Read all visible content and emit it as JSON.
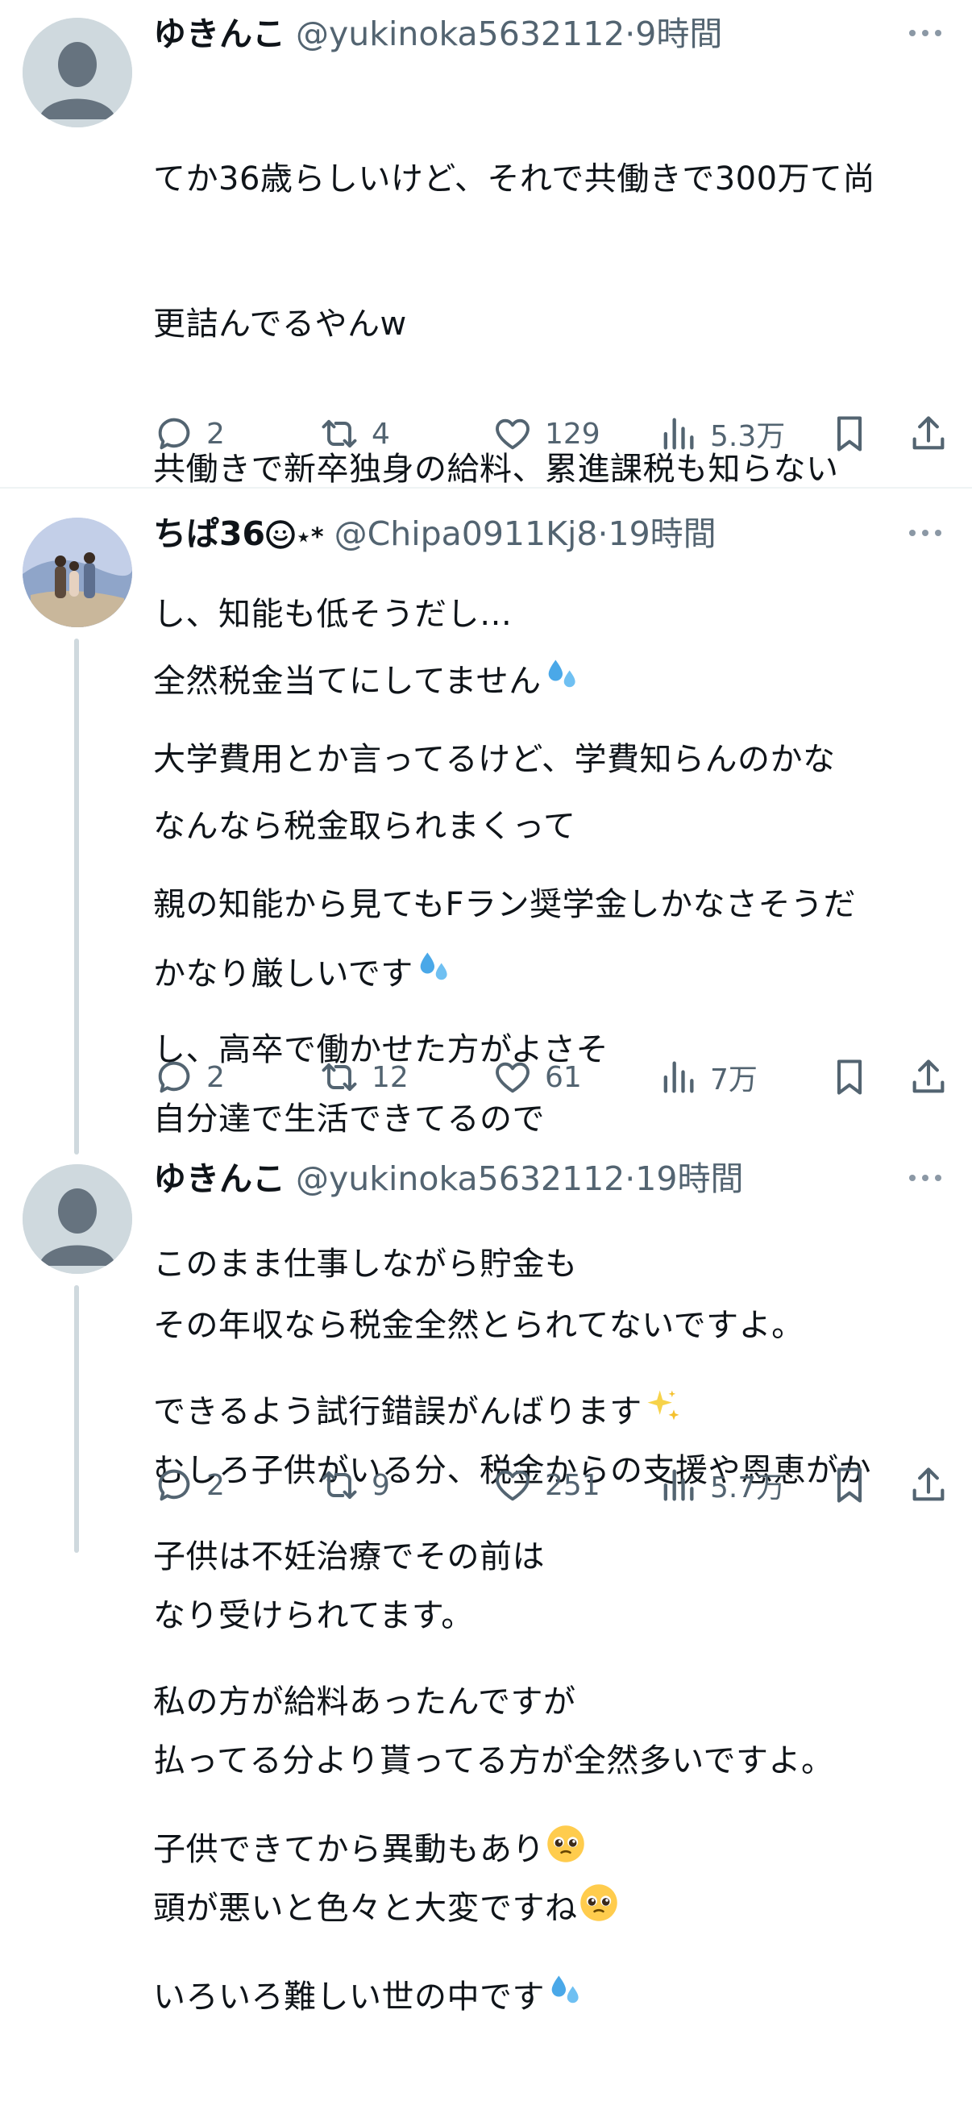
{
  "tweets": [
    {
      "name": "ゆきんこ",
      "handle": "@yukinoka5632112",
      "dot": "·",
      "time": "9時間",
      "lines": [
        "てか36歳らしいけど、それで共働きで300万て尚",
        "更詰んでるやんw",
        "共働きで新卒独身の給料、累進課税も知らない",
        "し、知能も低そうだし…",
        "大学費用とか言ってるけど、学費知らんのかな",
        "親の知能から見てもFラン奨学金しかなさそうだ",
        "し、高卒で働かせた方がよさそ"
      ],
      "replies": "2",
      "reposts": "4",
      "likes": "129",
      "views": "5.3万"
    },
    {
      "name": "ちぱ36",
      "name_suffix": "⋆*",
      "handle": "@Chipa0911Kj8",
      "dot": "·",
      "time": "19時間",
      "lines": [
        "全然税金当てにしてません",
        "なんなら税金取られまくって",
        "かなり厳しいです",
        "自分達で生活できてるので",
        "このまま仕事しながら貯金も",
        "できるよう試行錯誤がんばります",
        "子供は不妊治療でその前は",
        "私の方が給料あったんですが",
        "子供できてから異動もあり",
        "いろいろ難しい世の中です"
      ],
      "replies": "2",
      "reposts": "12",
      "likes": "61",
      "views": "7万"
    },
    {
      "name": "ゆきんこ",
      "handle": "@yukinoka5632112",
      "dot": "·",
      "time": "19時間",
      "lines": [
        "その年収なら税金全然とられてないですよ。",
        "むしろ子供がいる分、税金からの支援や恩恵がか",
        "なり受けられてます。",
        "払ってる分より貰ってる方が全然多いですよ。",
        "頭が悪いと色々と大変ですね"
      ],
      "replies": "2",
      "reposts": "9",
      "likes": "251",
      "views": "5.7万"
    }
  ],
  "icons": {
    "reply": "reply-icon",
    "repost": "repost-icon",
    "like": "like-icon",
    "views": "views-icon",
    "bookmark": "bookmark-icon",
    "share": "share-icon",
    "more": "more-icon",
    "sweat": "sweat-droplets-emoji",
    "sparkles": "sparkles-emoji",
    "pleading": "pleading-face-emoji",
    "smile": "smiling-face-emoji"
  },
  "colors": {
    "text": "#0f1419",
    "secondary": "#536471",
    "divider": "#eff3f4",
    "thread": "#cfd9de"
  }
}
